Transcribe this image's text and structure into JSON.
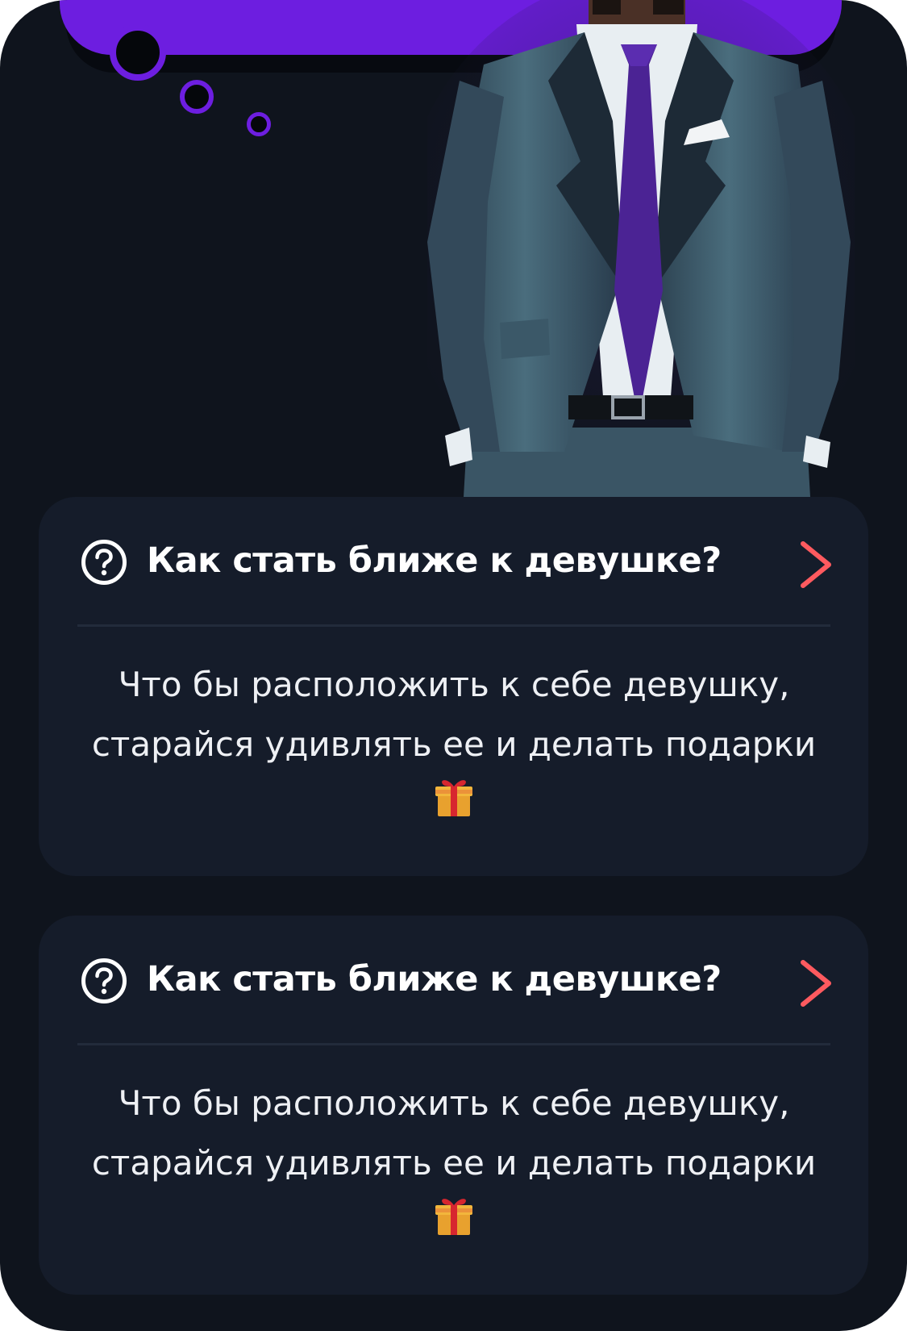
{
  "faq": [
    {
      "question": "Как стать ближе к девушке?",
      "answer_line_1": "Что бы расположить к себе девушку,",
      "answer_line_2": "старайся удивлять ее и делать подарки"
    },
    {
      "question": "Как стать ближе к девушке?",
      "answer_line_1": "Что бы расположить к себе девушку,",
      "answer_line_2": "старайся удивлять ее и делать подарки"
    }
  ],
  "icons": {
    "question": "question-circle-icon",
    "chevron": "chevron-right-icon",
    "gift": "gift-emoji"
  },
  "colors": {
    "background": "#0f141d",
    "card": "#151c2a",
    "accent_purple": "#6d1ee0",
    "chevron": "#ff5a5f",
    "text": "#ffffff"
  }
}
